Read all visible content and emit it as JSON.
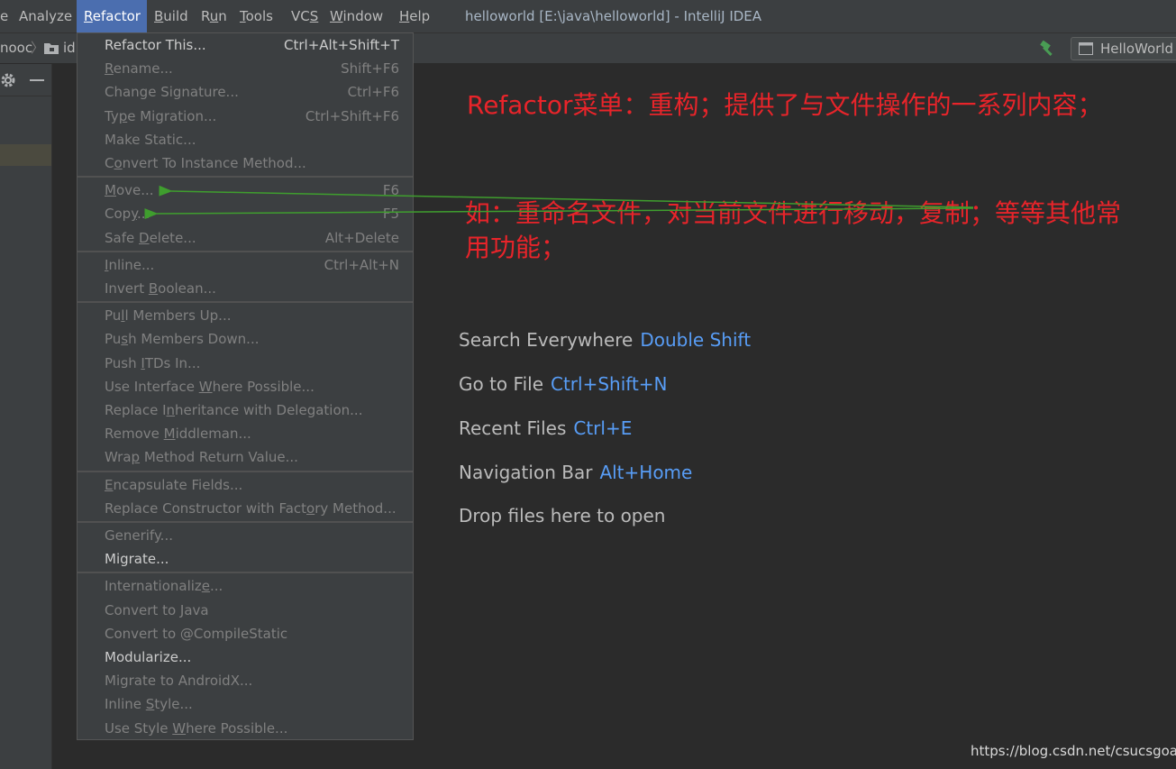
{
  "menubar": {
    "items": [
      {
        "label": "e",
        "mnemonic_index": -1
      },
      {
        "label": "Analyze",
        "mnemonic_index": -1
      },
      {
        "label": "Refactor",
        "mnemonic_index": 0,
        "active": true
      },
      {
        "label": "Build",
        "mnemonic_index": 0
      },
      {
        "label": "Run",
        "mnemonic_index": 1
      },
      {
        "label": "Tools",
        "mnemonic_index": 0
      },
      {
        "label": "VCS",
        "mnemonic_index": 2
      },
      {
        "label": "Window",
        "mnemonic_index": 0
      },
      {
        "label": "Help",
        "mnemonic_index": 0
      }
    ],
    "window_title": "helloworld [E:\\java\\helloworld] - IntelliJ IDEA"
  },
  "navbar": {
    "crumb_1": "nooc",
    "crumb_2": "id",
    "run_config": "HelloWorld"
  },
  "dropdown": {
    "items": [
      {
        "label": "Refactor This...",
        "shortcut": "Ctrl+Alt+Shift+T",
        "enabled": true,
        "mn": -1
      },
      {
        "label": "Rename...",
        "shortcut": "Shift+F6",
        "enabled": false,
        "mn": 0
      },
      {
        "label": "Change Signature...",
        "shortcut": "Ctrl+F6",
        "enabled": false,
        "mn": -1
      },
      {
        "label": "Type Migration...",
        "shortcut": "Ctrl+Shift+F6",
        "enabled": false,
        "mn": 2
      },
      {
        "label": "Make Static...",
        "shortcut": "",
        "enabled": false,
        "mn": -1
      },
      {
        "label": "Convert To Instance Method...",
        "shortcut": "",
        "enabled": false,
        "mn": 1
      },
      {
        "label": "Move...",
        "shortcut": "F6",
        "enabled": false,
        "mn": 0,
        "sep_before": true
      },
      {
        "label": "Copy...",
        "shortcut": "F5",
        "enabled": false,
        "mn": 3
      },
      {
        "label": "Safe Delete...",
        "shortcut": "Alt+Delete",
        "enabled": false,
        "mn": 5
      },
      {
        "label": "Inline...",
        "shortcut": "Ctrl+Alt+N",
        "enabled": false,
        "mn": 0,
        "sep_before": true
      },
      {
        "label": "Invert Boolean...",
        "shortcut": "",
        "enabled": false,
        "mn": 7
      },
      {
        "label": "Pull Members Up...",
        "shortcut": "",
        "enabled": false,
        "mn": 2,
        "sep_before": true
      },
      {
        "label": "Push Members Down...",
        "shortcut": "",
        "enabled": false,
        "mn": 2
      },
      {
        "label": "Push ITDs In...",
        "shortcut": "",
        "enabled": false,
        "mn": 5
      },
      {
        "label": "Use Interface Where Possible...",
        "shortcut": "",
        "enabled": false,
        "mn": 14
      },
      {
        "label": "Replace Inheritance with Delegation...",
        "shortcut": "",
        "enabled": false,
        "mn": 9
      },
      {
        "label": "Remove Middleman...",
        "shortcut": "",
        "enabled": false,
        "mn": 7
      },
      {
        "label": "Wrap Method Return Value...",
        "shortcut": "",
        "enabled": false,
        "mn": 3
      },
      {
        "label": "Encapsulate Fields...",
        "shortcut": "",
        "enabled": false,
        "mn": 0,
        "sep_before": true
      },
      {
        "label": "Replace Constructor with Factory Method...",
        "shortcut": "",
        "enabled": false,
        "mn": 29
      },
      {
        "label": "Generify...",
        "shortcut": "",
        "enabled": false,
        "mn": -1,
        "sep_before": true
      },
      {
        "label": "Migrate...",
        "shortcut": "",
        "enabled": true,
        "mn": -1
      },
      {
        "label": "Internationalize...",
        "shortcut": "",
        "enabled": false,
        "mn": 15,
        "sep_before": true
      },
      {
        "label": "Convert to Java",
        "shortcut": "",
        "enabled": false,
        "mn": -1
      },
      {
        "label": "Convert to @CompileStatic",
        "shortcut": "",
        "enabled": false,
        "mn": -1
      },
      {
        "label": "Modularize...",
        "shortcut": "",
        "enabled": true,
        "mn": -1
      },
      {
        "label": "Migrate to AndroidX...",
        "shortcut": "",
        "enabled": false,
        "mn": -1
      },
      {
        "label": "Inline Style...",
        "shortcut": "",
        "enabled": false,
        "mn": 7
      },
      {
        "label": "Use Style Where Possible...",
        "shortcut": "",
        "enabled": false,
        "mn": 10
      }
    ]
  },
  "annotations": {
    "line_1": "Refactor菜单：重构；提供了与文件操作的一系列内容；",
    "line_2": "如：重命名文件，对当前文件进行移动，复制；等等其他常",
    "line_3": "用功能；"
  },
  "hints": [
    {
      "label": "Search Everywhere",
      "key": "Double Shift"
    },
    {
      "label": "Go to File",
      "key": "Ctrl+Shift+N"
    },
    {
      "label": "Recent Files",
      "key": "Ctrl+E"
    },
    {
      "label": "Navigation Bar",
      "key": "Alt+Home"
    },
    {
      "label": "Drop files here to open",
      "key": ""
    }
  ],
  "watermark": "https://blog.csdn.net/csucsgoat",
  "colors": {
    "accent": "#4b6eaf",
    "annotation": "#e8242a",
    "arrow": "#3f9e2e",
    "shortcut_key": "#589df6"
  }
}
